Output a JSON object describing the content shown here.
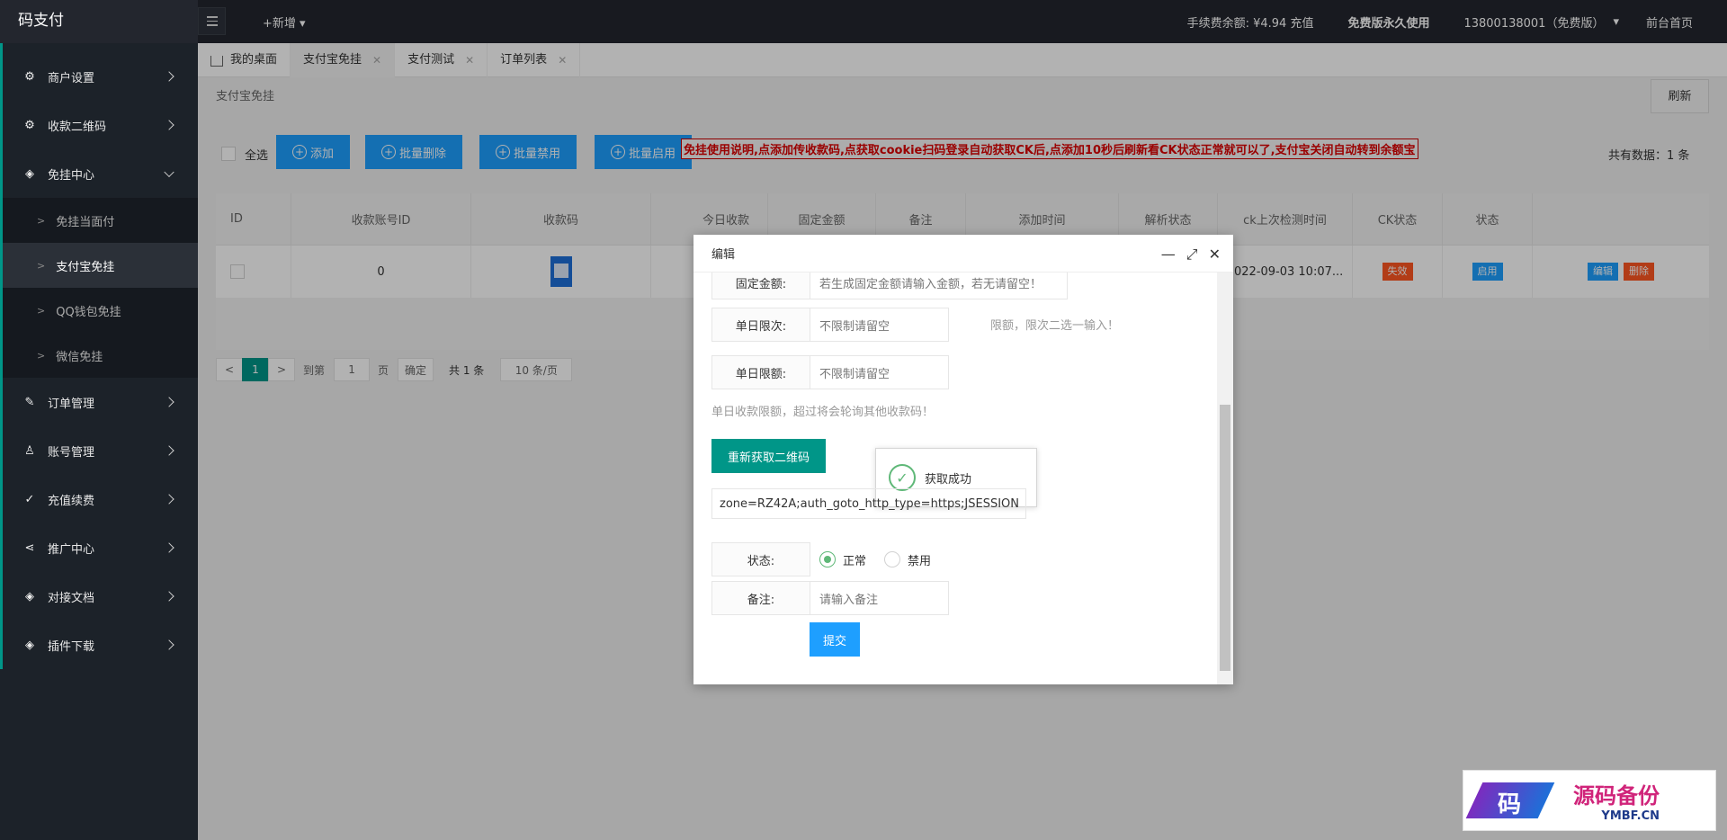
{
  "app": {
    "title": "码支付"
  },
  "topbar": {
    "new": "+新增 ▾",
    "fee_balance": "手续费余额: ¥4.94 充值",
    "plan": "免费版永久使用",
    "user": "13800138001（免费版）",
    "home": "前台首页"
  },
  "sidebar": {
    "items": [
      {
        "label": "商户设置"
      },
      {
        "label": "收款二维码"
      },
      {
        "label": "免挂中心",
        "open": true,
        "sub": [
          "免挂当面付",
          "支付宝免挂",
          "QQ钱包免挂",
          "微信免挂"
        ]
      },
      {
        "label": "订单管理"
      },
      {
        "label": "账号管理"
      },
      {
        "label": "充值续费"
      },
      {
        "label": "推广中心"
      },
      {
        "label": "对接文档"
      },
      {
        "label": "插件下载"
      }
    ]
  },
  "tabs": [
    "我的桌面",
    "支付宝免挂",
    "支付测试",
    "订单列表"
  ],
  "page": {
    "breadcrumb": "支付宝免挂",
    "refresh": "刷新"
  },
  "toolbar": {
    "select_all": "全选",
    "add": "添加",
    "batch_delete": "批量删除",
    "batch_disable": "批量禁用",
    "batch_enable": "批量启用",
    "notice": "免挂使用说明,点添加传收款码,点获取cookie扫码登录自动获取CK后,点添加10秒后刷新看CK状态正常就可以了,支付宝关闭自动转到余额宝",
    "total": "共有数据：1 条"
  },
  "table": {
    "headers": [
      "ID",
      "收款账号ID",
      "收款码",
      "今日收款",
      "固定金额",
      "备注",
      "添加时间",
      "解析状态",
      "ck上次检测时间",
      "CK状态",
      "状态",
      ""
    ],
    "row": {
      "account_id": "0",
      "check_time": "2022-09-03 10:07...",
      "ck_status": "失效",
      "status": "启用",
      "edit": "编辑",
      "delete": "删除"
    }
  },
  "pager": {
    "prev": "<",
    "current": "1",
    "next": ">",
    "goto": "到第",
    "page_val": "1",
    "page_unit": "页",
    "confirm": "确定",
    "total": "共 1 条",
    "size": "10 条/页"
  },
  "modal": {
    "title": "编辑",
    "fixed_label": "固定金额:",
    "fixed_placeholder": "若生成固定金额请输入金额，若无请留空！",
    "daily_count_label": "单日限次:",
    "daily_count_placeholder": "不限制请留空",
    "daily_count_hint": "限额，限次二选一输入！",
    "daily_amount_label": "单日限额:",
    "daily_amount_placeholder": "不限制请留空",
    "daily_amount_hint": "单日收款限额，超过将会轮询其他收款码！",
    "refresh_qr": "重新获取二维码",
    "toast": "获取成功",
    "cookie_value": "zone=RZ42A;auth_goto_http_type=https;JSESSION",
    "status_label": "状态:",
    "status_normal": "正常",
    "status_disabled": "禁用",
    "remark_label": "备注:",
    "remark_placeholder": "请输入备注",
    "submit": "提交"
  },
  "watermark": {
    "logo": "码",
    "text1": "源码备份",
    "text2": "YMBF.CN"
  }
}
